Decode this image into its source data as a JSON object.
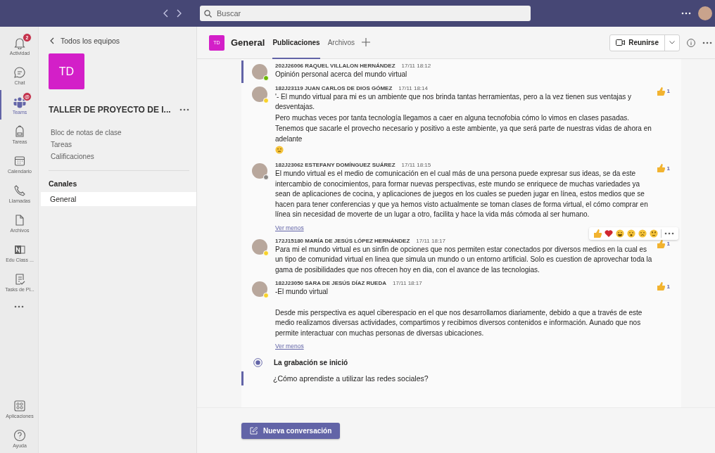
{
  "top_bar": {
    "search": {
      "placeholder": "Buscar"
    }
  },
  "rail": {
    "items": [
      {
        "label": "Actividad",
        "badge": "2",
        "selected": false
      },
      {
        "label": "Chat",
        "selected": false
      },
      {
        "label": "Teams",
        "badge": "@",
        "selected": true
      },
      {
        "label": "Tareas",
        "selected": false
      },
      {
        "label": "Calendario",
        "selected": false
      },
      {
        "label": "Llamadas",
        "selected": false
      },
      {
        "label": "Archivos",
        "selected": false
      },
      {
        "label": "Edu Class ...",
        "selected": false
      },
      {
        "label": "Tasks de Pl...",
        "selected": false
      }
    ],
    "bottom_items": [
      {
        "label": "Aplicaciones"
      },
      {
        "label": "Ayuda"
      }
    ]
  },
  "team_pane": {
    "back_link": "Todos los equipos",
    "tile": "TD",
    "team_name": "TALLER DE PROYECTO DE I...",
    "links": [
      "Bloc de notas de clase",
      "Tareas",
      "Calificaciones"
    ],
    "channels_heading": "Canales",
    "channels": [
      {
        "name": "General",
        "selected": true
      }
    ]
  },
  "channel": {
    "tile": "TD",
    "name": "General",
    "tabs": [
      {
        "label": "Publicaciones",
        "selected": true
      },
      {
        "label": "Archivos",
        "selected": false
      }
    ],
    "meet_button": "Reunirse",
    "feed": [
      {
        "kind": "message",
        "thread_start": true,
        "color": "#6bb700",
        "author": "202J26006 RAQUEL VILLALON HERNÁNDEZ",
        "time": "17/11 18:12",
        "paragraphs": [
          "Opinión personal acerca del mundo virtual"
        ]
      },
      {
        "kind": "message",
        "thread_start": false,
        "color": "#f8d22a",
        "author": "182J23119 JUAN CARLOS DE DIOS GÓMEZ",
        "time": "17/11 18:14",
        "reaction_count": "1",
        "paragraphs": [
          "'- El mundo virtual para mi es un ambiente que nos brinda tantas herramientas, pero a la vez tienen sus ventajas y desventajas.",
          "Pero muchas veces por tanta tecnología llegamos a caer en alguna tecnofobia cómo lo vimos en clases pasadas.",
          "Tenemos que sacarle el provecho necesario y positivo a este ambiente, ya que será parte de nuestras vidas de ahora en adelante"
        ],
        "trailing_emoji": true
      },
      {
        "kind": "message",
        "thread_start": false,
        "color": "#8a8886",
        "author": "182J23062 ESTEFANY DOMÍNGUEZ SUÁREZ",
        "time": "17/11 18:15",
        "reaction_count": "1",
        "paragraphs": [
          "El mundo virtual es el medio de comunicación en el cual más de una persona puede expresar sus ideas, se da este intercambio de conocimientos,  para formar nuevas perspectivas, este mundo se enriquece de muchas variedades ya sean de aplicaciones de cocina, y aplicaciones de juegos en los cuales se pueden jugar en línea, estos medios que se hacen para tener conferencias y que ya hemos visto actualmente se toman clases de forma virtual, el cómo comprar en línea sin necesidad de moverte de un lugar a otro, facilita y hace la vida más cómoda al ser humano."
        ],
        "toggle_link": "Ver menos",
        "reaction_bar": true
      },
      {
        "kind": "message",
        "thread_start": false,
        "color": "#f8d22a",
        "author": "172J15180 MARÍA DE JESÚS LÓPEZ HERNÁNDEZ",
        "time": "17/11 18:17",
        "reaction_count": "1",
        "paragraphs": [
          "Para mi el mundo virtual es un sinfin de opciones que nos permiten estar conectados por diversos medios en la cual es un tipo de comunidad virtual en linea que simula un mundo o un entorno artificial. Solo es cuestion de aprovechar toda la gama de posibilidades que nos ofrecen hoy en dia, con el avance de las tecnologias."
        ]
      },
      {
        "kind": "message",
        "thread_start": false,
        "color": "#f8d22a",
        "author": "182J23050 SARA DE JESÚS DÍAZ RUEDA",
        "time": "17/11 18:17",
        "reaction_count": "1",
        "paragraphs": [
          "-El mundo virtual",
          "Desde mis perspectiva es aquel ciberespacio en el que nos desarrollamos diariamente, debido a que a través de este medio realizamos diversas actividades, compartimos y recibimos diversos contenidos e información. Aunado que nos permite interactuar con muchas personas de diversas ubicaciones."
        ],
        "toggle_link": "Ver menos"
      },
      {
        "kind": "event",
        "text": "La grabación se inició"
      },
      {
        "kind": "subject",
        "thread_start": true,
        "text": "¿Cómo aprendiste a utilizar las redes sociales?"
      }
    ],
    "new_conversation_button": "Nueva conversación"
  }
}
